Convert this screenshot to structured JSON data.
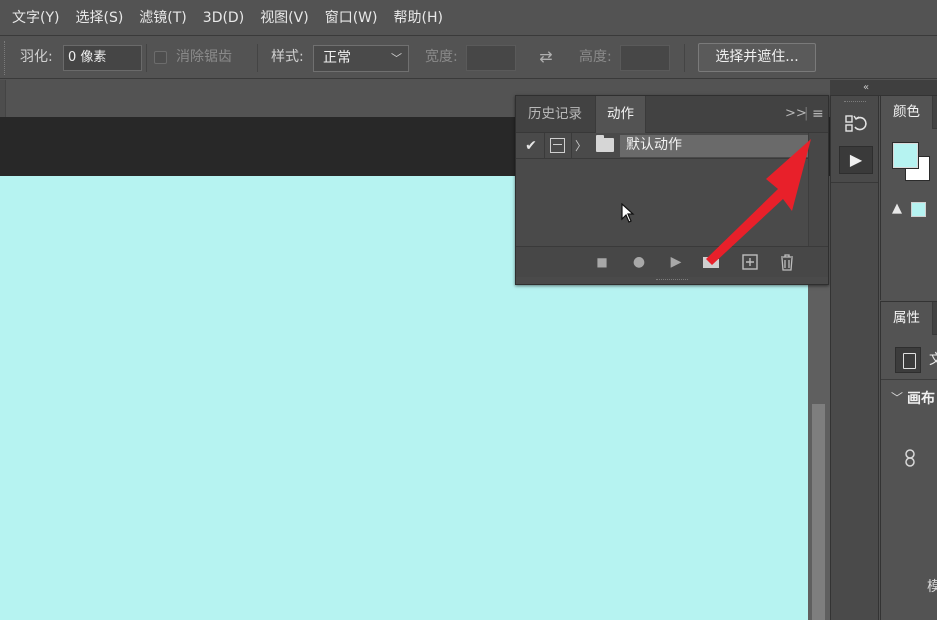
{
  "menu": {
    "items": [
      "文字(Y)",
      "选择(S)",
      "滤镜(T)",
      "3D(D)",
      "视图(V)",
      "窗口(W)",
      "帮助(H)"
    ]
  },
  "options": {
    "feather_label": "羽化:",
    "feather_value": "0 像素",
    "antialias_label": "消除锯齿",
    "style_label": "样式:",
    "style_value": "正常",
    "width_label": "宽度:",
    "height_label": "高度:",
    "select_mask_label": "选择并遮住..."
  },
  "actions_panel": {
    "tabs": [
      "历史记录",
      "动作"
    ],
    "active_tab": "动作",
    "action_set_name": "默认动作"
  },
  "dock": {
    "color_panel_title": "颜色",
    "properties_panel_title": "属性",
    "doc_label": "文",
    "canvas_section_label": "画布",
    "mode_label": "模"
  },
  "colors": {
    "foreground": "#b6f3f1",
    "background": "#ffffff",
    "canvas": "#b6f3f1",
    "annotation_arrow": "#e8202a"
  }
}
